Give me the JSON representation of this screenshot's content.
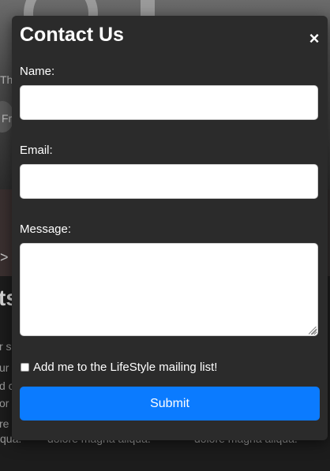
{
  "background": {
    "hero_lines": [
      "Th",
      "Fr"
    ],
    "section_heading": "ts",
    "col_fragments": [
      "r s",
      "ur",
      "d c",
      "or",
      "re"
    ],
    "bottom_left": "qua.",
    "bottom_mid": "dolore magna aliqua.",
    "bottom_right": "dolore magna aliqua.",
    "arrow": ">"
  },
  "modal": {
    "title": "Contact Us",
    "close_glyph": "×",
    "name_label": "Name:",
    "name_value": "",
    "email_label": "Email:",
    "email_value": "",
    "message_label": "Message:",
    "message_value": "",
    "mailing_list_label": "Add me to the LifeStyle mailing list!",
    "mailing_list_checked": false,
    "submit_label": "Submit"
  },
  "colors": {
    "modal_bg": "#2b2b2b",
    "submit_accent": "#0b7bff",
    "text": "#ffffff"
  }
}
